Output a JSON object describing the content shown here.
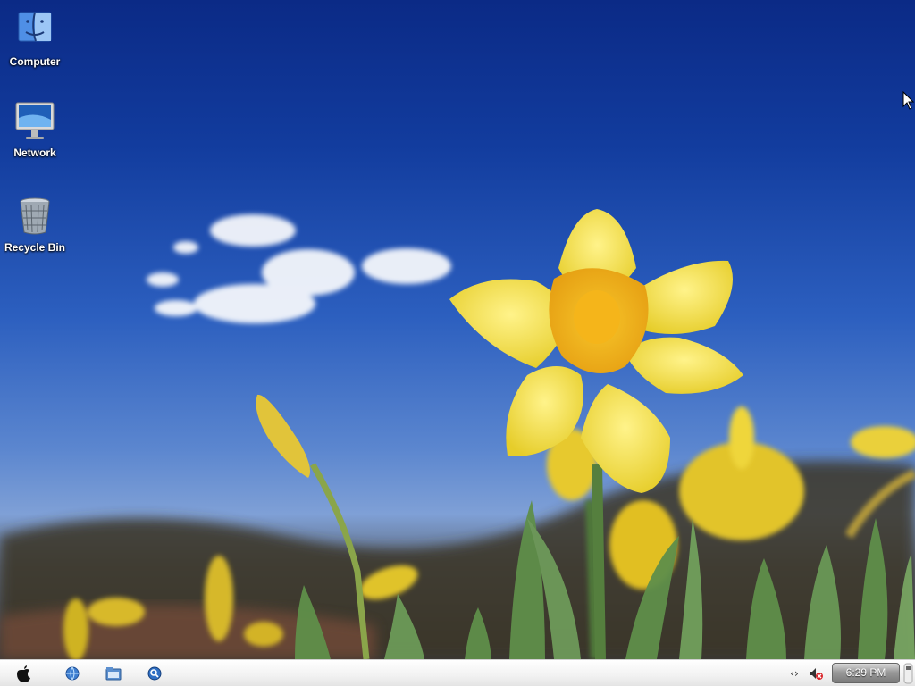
{
  "desktop": {
    "icons": [
      {
        "label": "Computer",
        "icon": "finder-computer-icon"
      },
      {
        "label": "Network",
        "icon": "imac-network-icon"
      },
      {
        "label": "Recycle Bin",
        "icon": "trash-can-icon"
      }
    ],
    "wallpaper": "yellow daffodils against blue sky"
  },
  "taskbar": {
    "start_icon": "apple-logo-icon",
    "quick_launch": [
      "browser-globe-icon",
      "file-manager-icon",
      "search-magnifier-icon"
    ],
    "tray": [
      "network-arrows-icon",
      "speaker-muted-icon"
    ],
    "clock": "6:29 PM"
  },
  "colors": {
    "sky": "#1a44a8",
    "petal": "#f4e04a",
    "trumpet": "#f2b81c",
    "stem": "#5f8f4a"
  }
}
